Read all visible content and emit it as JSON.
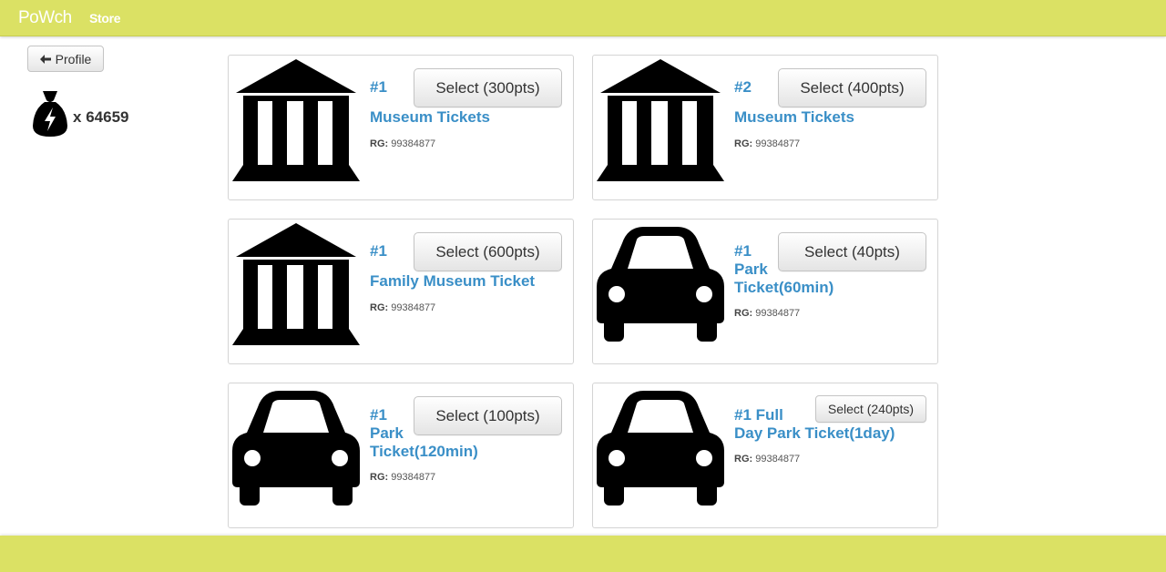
{
  "header": {
    "brand": "PoWch",
    "nav_store": "Store"
  },
  "sidebar": {
    "profile_button": "Profile",
    "points_prefix": "x",
    "points_value": "64659"
  },
  "cards": [
    {
      "rank": "#1",
      "name": "Museum Tickets",
      "rg_label": "RG:",
      "rg_value": "99384877",
      "select_label": "Select (300pts)",
      "icon": "museum-icon"
    },
    {
      "rank": "#2",
      "name": "Museum Tickets",
      "rg_label": "RG:",
      "rg_value": "99384877",
      "select_label": "Select (400pts)",
      "icon": "museum-icon"
    },
    {
      "rank": "#1",
      "name": "Family Museum Ticket",
      "rg_label": "RG:",
      "rg_value": "99384877",
      "select_label": "Select (600pts)",
      "icon": "museum-icon"
    },
    {
      "rank": "#1",
      "name": "Park",
      "name2": "Ticket(60min)",
      "rg_label": "RG:",
      "rg_value": "99384877",
      "select_label": "Select (40pts)",
      "icon": "car-icon"
    },
    {
      "rank": "#1",
      "name": "Park",
      "name2": "Ticket(120min)",
      "rg_label": "RG:",
      "rg_value": "99384877",
      "select_label": "Select (100pts)",
      "icon": "car-icon"
    },
    {
      "rank": "#1 Full",
      "name": "Day Park Ticket(1day)",
      "rg_label": "RG:",
      "rg_value": "99384877",
      "select_label": "Select (240pts)",
      "icon": "car-icon"
    }
  ],
  "colors": {
    "accent_bar": "#dbe164",
    "link_blue": "#3a8fc7"
  }
}
